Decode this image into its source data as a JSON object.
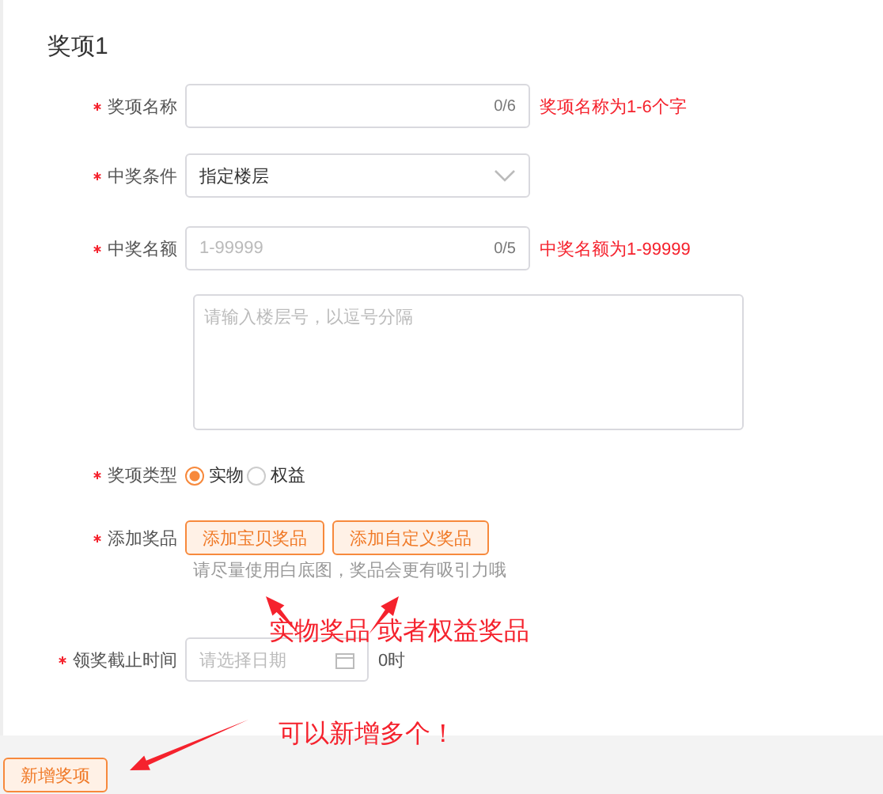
{
  "section_title": "奖项1",
  "fields": [
    {
      "kind": "text",
      "label": "奖项名称",
      "required": true,
      "counter": "0/6",
      "hint": "奖项名称为1-6个字"
    },
    {
      "kind": "select",
      "label": "中奖条件",
      "required": true,
      "value": "指定楼层"
    },
    {
      "kind": "text",
      "label": "中奖名额",
      "required": true,
      "placeholder": "1-99999",
      "counter": "0/5",
      "hint": "中奖名额为1-99999"
    },
    {
      "kind": "textarea",
      "placeholder": "请输入楼层号，以逗号分隔"
    },
    {
      "kind": "radio",
      "label": "奖项类型",
      "required": true,
      "options": [
        {
          "label": "实物",
          "selected": true
        },
        {
          "label": "权益",
          "selected": false
        }
      ]
    },
    {
      "kind": "buttons",
      "label": "添加奖品",
      "required": true,
      "buttons": [
        "添加宝贝奖品",
        "添加自定义奖品"
      ],
      "note": "请尽量使用白底图，奖品会更有吸引力哦"
    },
    {
      "kind": "date",
      "label": "领奖截止时间",
      "required": true,
      "placeholder": "请选择日期",
      "suffix": "0时"
    }
  ],
  "add_button": "新增奖项",
  "annotations": [
    {
      "text": "实物奖品 或者权益奖品"
    },
    {
      "text": "可以新增多个！"
    }
  ]
}
